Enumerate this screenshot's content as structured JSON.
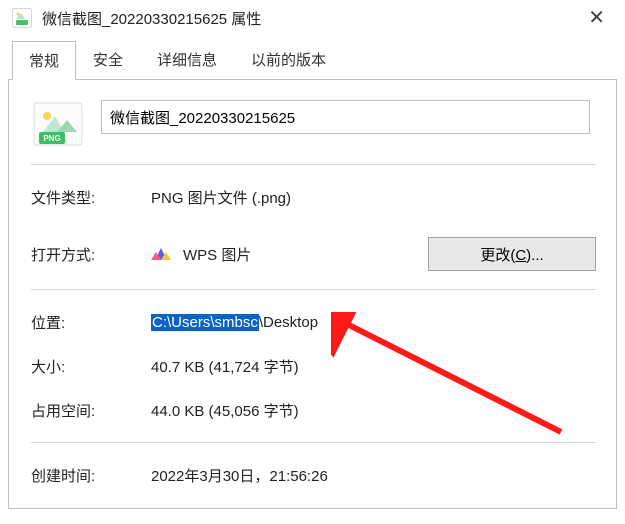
{
  "window": {
    "title": "微信截图_20220330215625 属性",
    "close_label": "✕"
  },
  "tabs": {
    "general": "常规",
    "security": "安全",
    "details": "详细信息",
    "previous": "以前的版本"
  },
  "file": {
    "name": "微信截图_20220330215625"
  },
  "labels": {
    "file_type": "文件类型:",
    "open_with": "打开方式:",
    "location": "位置:",
    "size": "大小:",
    "size_on_disk": "占用空间:",
    "created": "创建时间:"
  },
  "values": {
    "file_type": "PNG 图片文件 (.png)",
    "open_with_app": "WPS 图片",
    "location_selected": "C:\\Users\\smbsc",
    "location_rest": "\\Desktop",
    "size": "40.7 KB (41,724 字节)",
    "size_on_disk": "44.0 KB (45,056 字节)",
    "created": "2022年3月30日，21:56:26"
  },
  "buttons": {
    "change_prefix": "更改(",
    "change_mnemonic": "C",
    "change_suffix": ")..."
  },
  "icons": {
    "png_badge": "PNG"
  }
}
